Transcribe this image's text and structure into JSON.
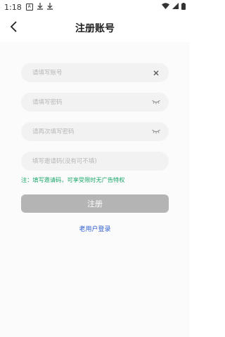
{
  "status_bar": {
    "time": "1:18",
    "notif_icons": [
      "a-box-icon",
      "download-icon",
      "download-icon"
    ],
    "right_icons": [
      "wifi-icon",
      "signal-icon",
      "battery-icon"
    ]
  },
  "header": {
    "title": "注册账号",
    "back_icon": "chevron-left-icon"
  },
  "form": {
    "account_placeholder": "请填写账号",
    "password_placeholder": "请填写密码",
    "confirm_placeholder": "请再次填写密码",
    "invite_placeholder": "填写邀请码(没有可不填)",
    "clear_icon": "close-icon",
    "eye_icon": "eye-closed-icon"
  },
  "note": "注：填写邀请码，可享受限时无广告特权",
  "register_label": "注册",
  "old_user_label": "老用户登录",
  "colors": {
    "note": "#1aa86a",
    "button_bg": "#b4b4b4",
    "link": "#2f5fd6",
    "field_bg": "#f2f2f2"
  }
}
